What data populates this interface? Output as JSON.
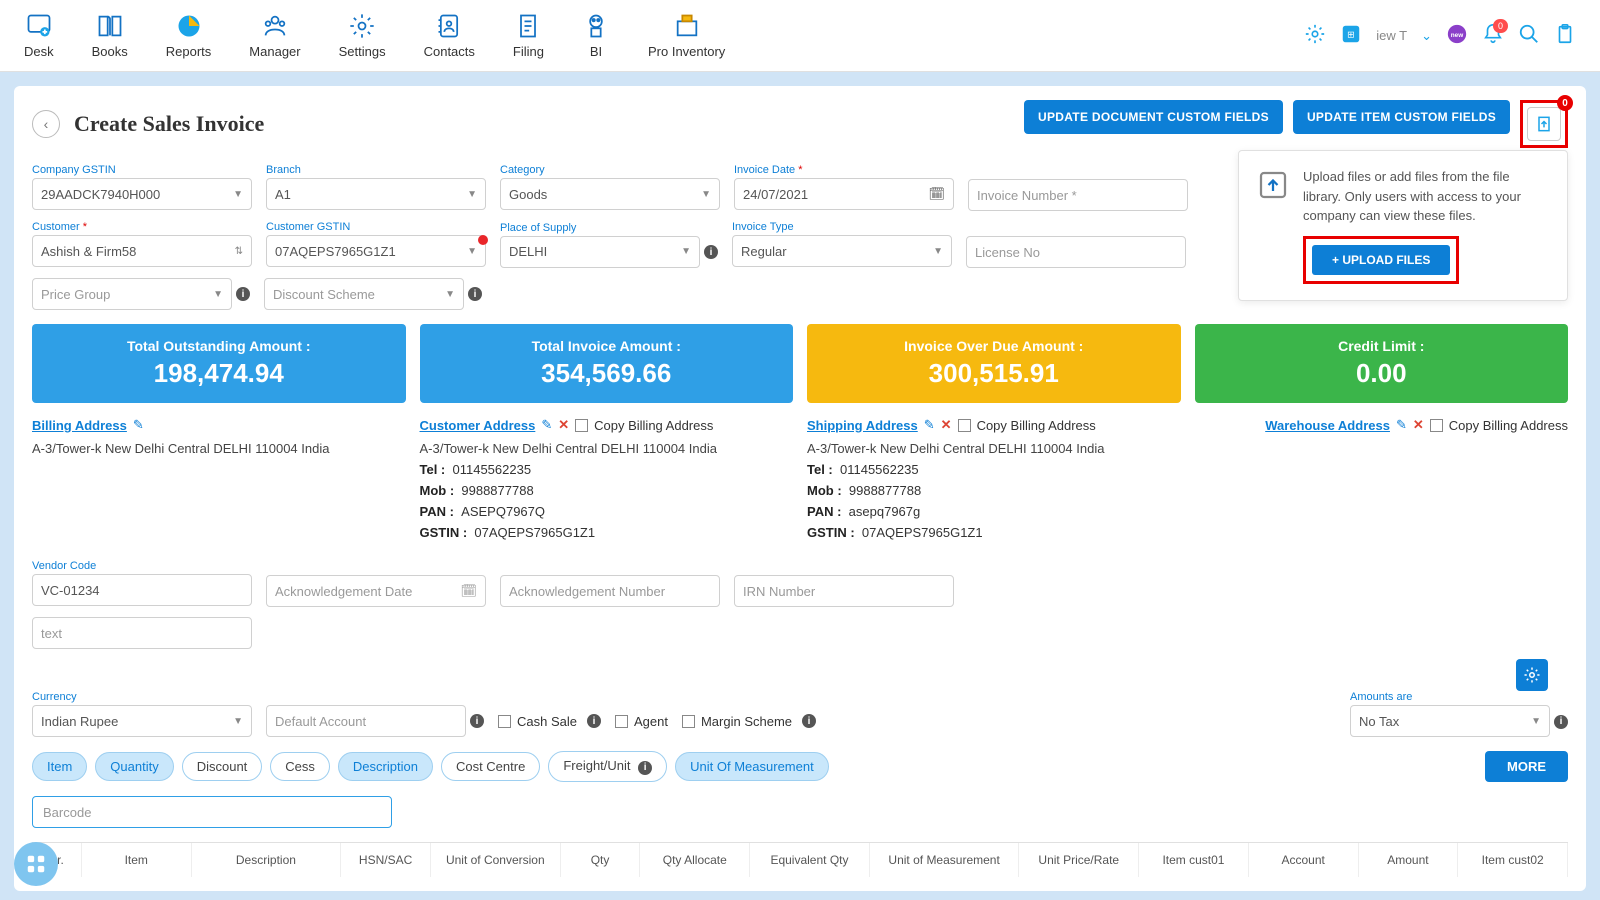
{
  "nav": {
    "items": [
      {
        "label": "Desk"
      },
      {
        "label": "Books"
      },
      {
        "label": "Reports"
      },
      {
        "label": "Manager"
      },
      {
        "label": "Settings"
      },
      {
        "label": "Contacts"
      },
      {
        "label": "Filing"
      },
      {
        "label": "BI"
      },
      {
        "label": "Pro Inventory"
      }
    ],
    "tenant": "iew T",
    "notif_count": "0"
  },
  "page": {
    "title": "Create Sales Invoice",
    "btn_doc_cf": "UPDATE DOCUMENT CUSTOM FIELDS",
    "btn_item_cf": "UPDATE ITEM CUSTOM FIELDS",
    "attach_badge": "0",
    "popover": "Upload files or add files from the file library. Only users with access to your company can view these files.",
    "upload_btn": "+ UPLOAD FILES"
  },
  "fields": {
    "company_gstin": {
      "label": "Company GSTIN",
      "value": "29AADCK7940H000"
    },
    "branch": {
      "label": "Branch",
      "value": "A1"
    },
    "category": {
      "label": "Category",
      "value": "Goods"
    },
    "invoice_date": {
      "label": "Invoice Date",
      "value": "24/07/2021"
    },
    "invoice_number": {
      "placeholder": "Invoice Number *"
    },
    "customer": {
      "label": "Customer",
      "value": "Ashish & Firm58"
    },
    "customer_gstin": {
      "label": "Customer GSTIN",
      "value": "07AQEPS7965G1Z1"
    },
    "pos": {
      "label": "Place of Supply",
      "value": "DELHI"
    },
    "invoice_type": {
      "label": "Invoice Type",
      "value": "Regular"
    },
    "license": {
      "placeholder": "License No"
    },
    "price_group": {
      "placeholder": "Price Group"
    },
    "discount_scheme": {
      "placeholder": "Discount Scheme"
    },
    "vendor_code": {
      "label": "Vendor Code",
      "value": "VC-01234"
    },
    "ack_date": {
      "placeholder": "Acknowledgement Date"
    },
    "ack_no": {
      "placeholder": "Acknowledgement Number"
    },
    "irn": {
      "placeholder": "IRN Number"
    },
    "text": {
      "placeholder": "text"
    },
    "currency": {
      "label": "Currency",
      "value": "Indian Rupee"
    },
    "default_acct": {
      "placeholder": "Default Account"
    },
    "cash_sale": "Cash Sale",
    "agent": "Agent",
    "margin": "Margin Scheme",
    "amounts_are": {
      "label": "Amounts are",
      "value": "No Tax"
    },
    "barcode": {
      "placeholder": "Barcode"
    }
  },
  "summary": [
    {
      "label": "Total Outstanding Amount :",
      "value": "198,474.94",
      "cls": "blue"
    },
    {
      "label": "Total Invoice Amount :",
      "value": "354,569.66",
      "cls": "blue"
    },
    {
      "label": "Invoice Over Due Amount :",
      "value": "300,515.91",
      "cls": "orange"
    },
    {
      "label": "Credit Limit :",
      "value": "0.00",
      "cls": "green"
    }
  ],
  "addr": {
    "billing": {
      "title": "Billing Address",
      "line": "A-3/Tower-k New Delhi Central DELHI 110004 India"
    },
    "customer": {
      "title": "Customer Address",
      "copy": "Copy Billing Address",
      "line": "A-3/Tower-k New Delhi Central DELHI 110004 India",
      "tel": "01145562235",
      "mob": "9988877788",
      "pan": "ASEPQ7967Q",
      "gstin": "07AQEPS7965G1Z1"
    },
    "shipping": {
      "title": "Shipping Address",
      "copy": "Copy Billing Address",
      "line": "A-3/Tower-k New Delhi Central DELHI 110004 India",
      "tel": "01145562235",
      "mob": "9988877788",
      "pan": "asepq7967g",
      "gstin": "07AQEPS7965G1Z1"
    },
    "warehouse": {
      "title": "Warehouse Address",
      "copy": "Copy Billing Address"
    }
  },
  "pills": [
    "Item",
    "Quantity",
    "Discount",
    "Cess",
    "Description",
    "Cost Centre",
    "Freight/Unit",
    "Unit Of Measurement"
  ],
  "pills_active": [
    1,
    2,
    5,
    8
  ],
  "more": "MORE",
  "table_cols": [
    "Sr.",
    "Item",
    "Description",
    "HSN/SAC",
    "Unit of Conversion",
    "Qty",
    "Qty Allocate",
    "Equivalent Qty",
    "Unit of Measurement",
    "Unit Price/Rate",
    "Item cust01",
    "Account",
    "Amount",
    "Item cust02"
  ]
}
